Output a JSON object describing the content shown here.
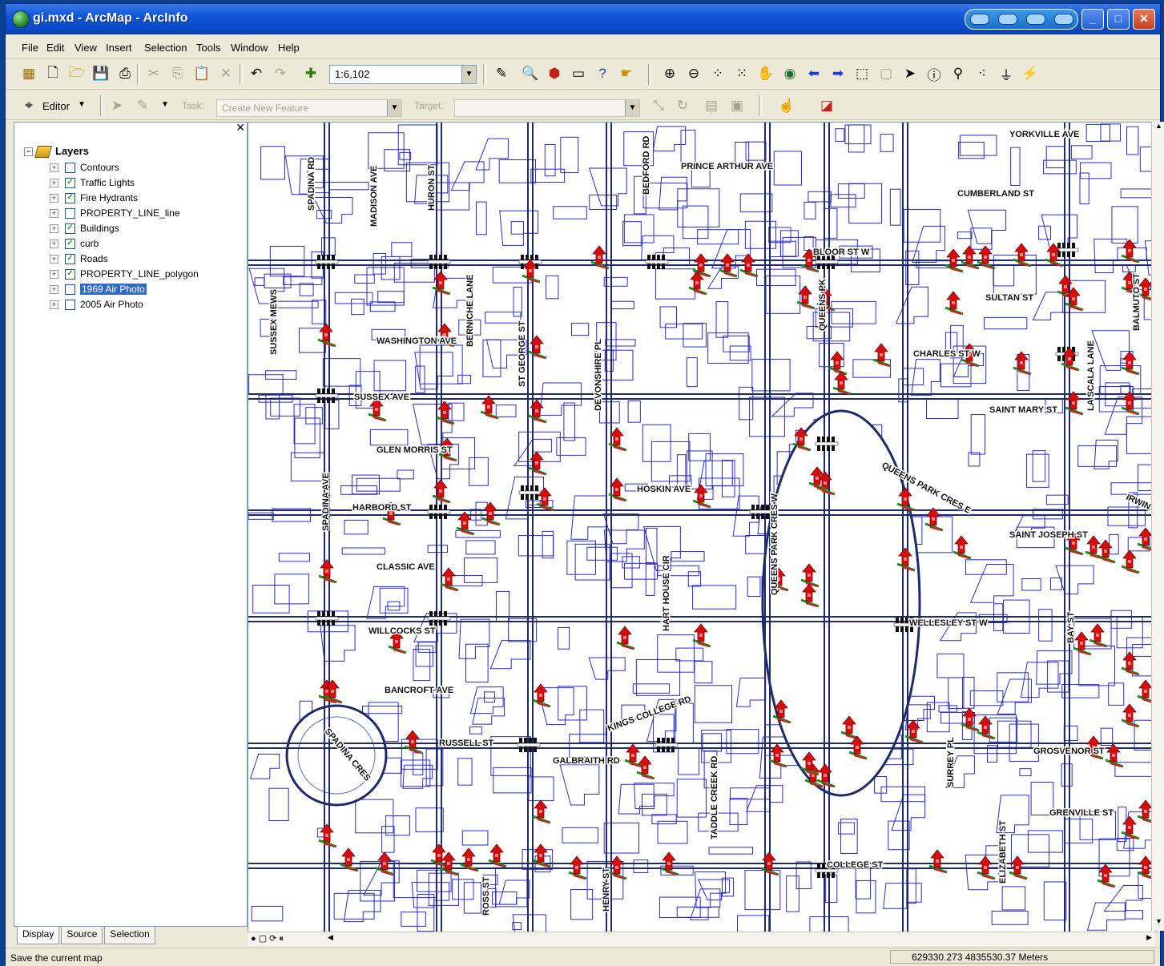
{
  "window": {
    "title": "gi.mxd - ArcMap - ArcInfo"
  },
  "menu": [
    "File",
    "Edit",
    "View",
    "Insert",
    "Selection",
    "Tools",
    "Window",
    "Help"
  ],
  "toolbar": {
    "scale": "1:6,102"
  },
  "editor": {
    "label": "Editor",
    "task_label": "Task:",
    "task_value": "Create New Feature",
    "target_label": "Target:"
  },
  "toc": {
    "root": "Layers",
    "layers": [
      {
        "name": "Contours",
        "checked": false
      },
      {
        "name": "Traffic Lights",
        "checked": true
      },
      {
        "name": "Fire Hydrants",
        "checked": true
      },
      {
        "name": "PROPERTY_LINE_line",
        "checked": false
      },
      {
        "name": "Buildings",
        "checked": true
      },
      {
        "name": "curb",
        "checked": true
      },
      {
        "name": "Roads",
        "checked": true
      },
      {
        "name": "PROPERTY_LINE_polygon",
        "checked": true
      },
      {
        "name": "1969 Air Photo",
        "checked": false,
        "selected": true
      },
      {
        "name": "2005 Air Photo",
        "checked": false
      }
    ],
    "tabs": [
      "Display",
      "Source",
      "Selection"
    ]
  },
  "map": {
    "streets": [
      "YORKVILLE AVE",
      "PRINCE ARTHUR AVE",
      "CUMBERLAND ST",
      "BLOOR ST W",
      "SULTAN ST",
      "CHARLES ST W",
      "SAINT MARY ST",
      "WASHINGTON AVE",
      "SUSSEX AVE",
      "GLEN MORRIS ST",
      "HOSKIN AVE",
      "HARBORD ST",
      "SAINT JOSEPH ST",
      "CLASSIC AVE",
      "WELLESLEY ST W",
      "WILLCOCKS ST",
      "BANCROFT AVE",
      "KINGS COLLEGE RD",
      "RUSSELL ST",
      "GALBRAITH RD",
      "GROSVENOR ST",
      "GRENVILLE ST",
      "COLLEGE ST",
      "QUEENS PARK CRES E",
      "QUEENS PARK CRES W",
      "SPADINA RD",
      "MADISON AVE",
      "HURON ST",
      "BEDFORD RD",
      "SUSSEX MEWS",
      "ST GEORGE ST",
      "BERNICHE LANE",
      "DEVONSHIRE PL",
      "QUEENS PK",
      "SPADINA AVE",
      "HART HOUSE CIR",
      "SPADINA CRES",
      "TADDLE CREEK RD",
      "SURREY PL",
      "BAY ST",
      "LA SCALA LANE",
      "BALMUTO ST",
      "IRWIN AVE",
      "ELIZABETH ST",
      "HENRY ST",
      "ROSS ST"
    ]
  },
  "status": {
    "message": "Save the current map",
    "coordinates": "629330.273  4835530.37 Meters"
  }
}
